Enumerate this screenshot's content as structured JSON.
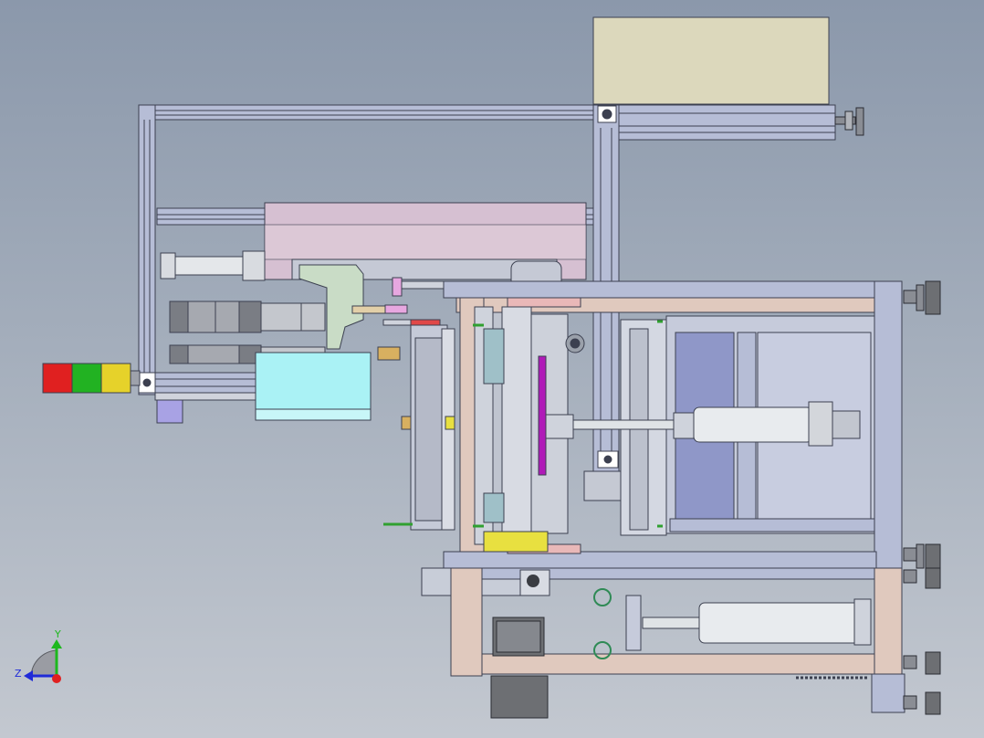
{
  "viewport": {
    "background_top": "#8b98ab",
    "background_bottom": "#c3c8d0"
  },
  "colors": {
    "profile": "#b6bdd6",
    "profile_edge": "#3c4050",
    "frame_wood": "#e0c9be",
    "panel_pink": "#d6c0d2",
    "box_beige": "#dcd8bc",
    "box_cyan": "#aaf2f5",
    "panel_blue": "#8f97c8",
    "cylinder": "#dfe3e6",
    "motor_dark": "#6d6f73",
    "light_red": "#e02020",
    "light_green": "#22b222",
    "light_yellow": "#e6d22a",
    "accent_magenta": "#b01ab8",
    "accent_yellow": "#e8e040",
    "green_sprocket": "#2f8a55"
  },
  "triad": {
    "y_label": "Y",
    "z_label": "Z"
  }
}
